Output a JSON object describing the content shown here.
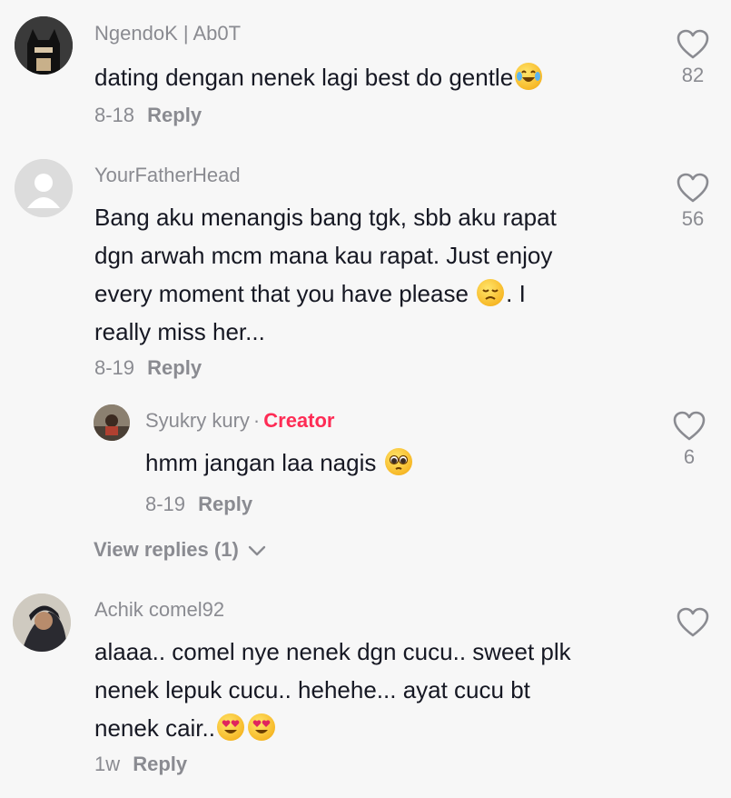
{
  "comments": [
    {
      "username": "NgendoK | Ab0T",
      "text": "dating dengan nenek lagi best do gentle",
      "date": "8-18",
      "reply_label": "Reply",
      "likes": "82",
      "emoji": "joy-emoji"
    },
    {
      "username": "YourFatherHead",
      "text_lines": [
        "Bang aku menangis bang tgk, sbb aku rapat",
        "dgn arwah mcm mana kau rapat. Just enjoy",
        "every moment that you have please",
        "really miss her..."
      ],
      "text_after_emoji": ". I",
      "date": "8-19",
      "reply_label": "Reply",
      "likes": "56",
      "emoji": "disappointed-emoji",
      "reply": {
        "username": "Syukry kury",
        "badge": "Creator",
        "text": "hmm jangan laa nagis",
        "date": "8-19",
        "reply_label": "Reply",
        "likes": "6",
        "emoji": "pleading-emoji"
      },
      "view_replies": "View replies (1)"
    },
    {
      "username": "Achik comel92",
      "text_lines": [
        "alaaa.. comel nye nenek dgn cucu.. sweet plk",
        "nenek lepuk cucu.. hehehe... ayat cucu bt",
        "nenek cair.."
      ],
      "date": "1w",
      "reply_label": "Reply",
      "likes": "",
      "emoji": "heart-eyes-emoji"
    }
  ],
  "colors": {
    "background": "#f7f7f7",
    "text": "#161823",
    "muted": "#8a8b91",
    "creator": "#fe2c55"
  }
}
